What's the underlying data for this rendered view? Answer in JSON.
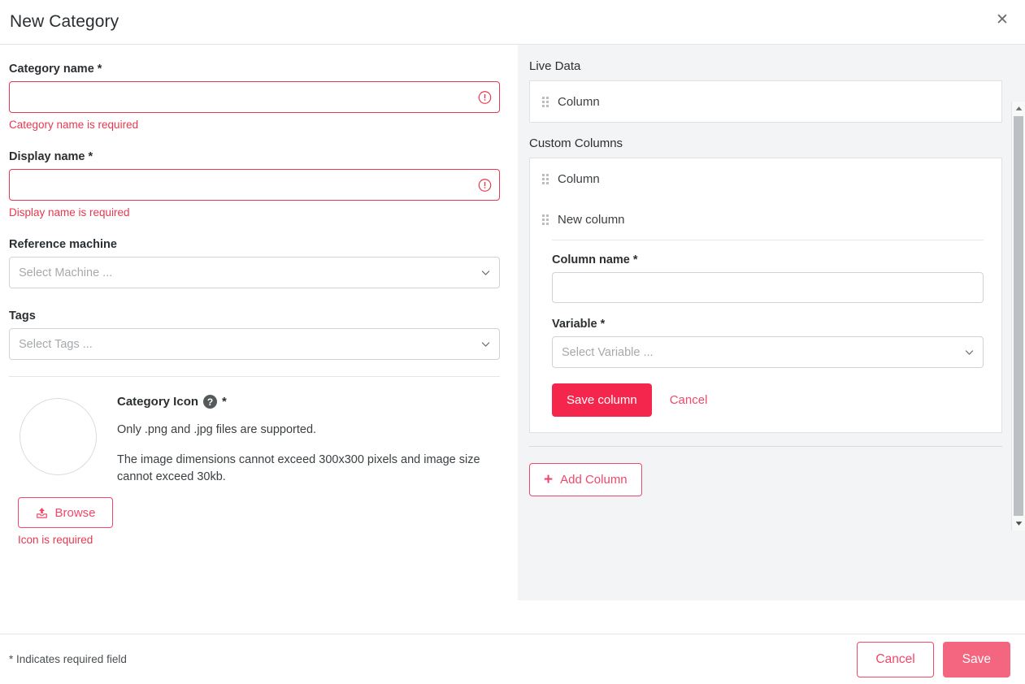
{
  "dialog": {
    "title": "New Category",
    "close_label": "✕"
  },
  "form": {
    "category_name": {
      "label": "Category name *",
      "value": "",
      "placeholder": "",
      "error": "Category name is required"
    },
    "display_name": {
      "label": "Display name *",
      "value": "",
      "placeholder": "",
      "error": "Display name is required"
    },
    "reference_machine": {
      "label": "Reference machine",
      "placeholder": "Select Machine ...",
      "value": ""
    },
    "tags": {
      "label": "Tags",
      "placeholder": "Select Tags ...",
      "value": ""
    },
    "category_icon": {
      "title": "Category Icon",
      "help_glyph": "?",
      "required_mark": "*",
      "note_1": "Only .png and .jpg files are supported.",
      "note_2": "The image dimensions cannot exceed 300x300 pixels and image size cannot exceed 30kb.",
      "browse_label": "Browse",
      "error": "Icon is required"
    }
  },
  "right_panel": {
    "live_data": {
      "label": "Live Data",
      "columns": [
        {
          "name": "Column"
        }
      ]
    },
    "custom_columns": {
      "label": "Custom Columns",
      "columns": [
        {
          "name": "Column"
        },
        {
          "name": "New column"
        }
      ],
      "editor": {
        "column_name": {
          "label": "Column name *",
          "value": "",
          "placeholder": ""
        },
        "variable": {
          "label": "Variable *",
          "placeholder": "Select Variable ...",
          "value": ""
        },
        "save_label": "Save column",
        "cancel_label": "Cancel"
      },
      "add_column_label": "Add Column",
      "add_column_glyph": "+"
    }
  },
  "footer": {
    "required_note": "* Indicates required field",
    "cancel_label": "Cancel",
    "save_label": "Save"
  },
  "colors": {
    "accent": "#f0476a",
    "accent_strong": "#f5264d",
    "accent_muted": "#f4657f",
    "error": "#e8384f",
    "panel_bg": "#f2f4f5",
    "text": "#2b2f32"
  }
}
